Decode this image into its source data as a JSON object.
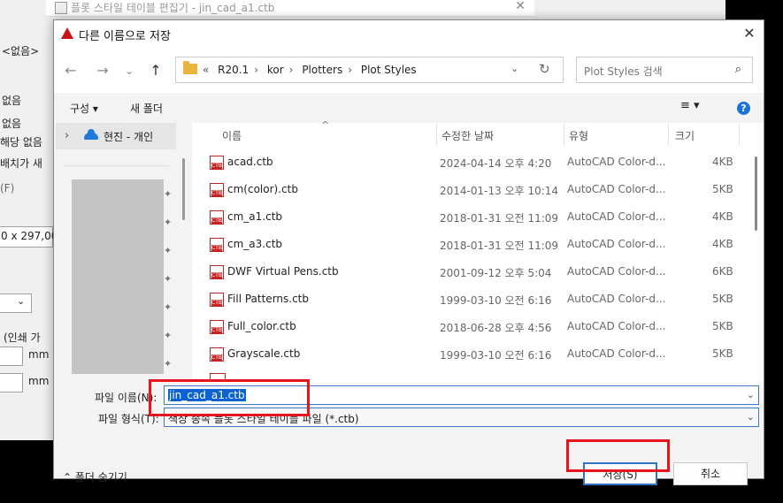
{
  "background_window": {
    "title": "플롯 스타일 테이블 편집기 - jin_cad_a1.ctb",
    "left_texts": [
      "<없음>",
      "없음",
      "없음",
      "해당 없음",
      "배치가 새",
      "(F)",
      "0 x 297,00",
      "(인쇄 가",
      "mm",
      "mm"
    ]
  },
  "dialog": {
    "title": "다른 이름으로 저장",
    "close": "✕"
  },
  "nav": {
    "back": "←",
    "forward": "→",
    "recent": "⌄",
    "up": "↑",
    "address_prefix": "«",
    "breadcrumbs": [
      "R20.1",
      "kor",
      "Plotters",
      "Plot Styles"
    ],
    "address_dropdown": "⌄",
    "refresh": "↻",
    "search_placeholder": "Plot Styles 검색",
    "search_icon_glyph": "⌕"
  },
  "toolbar": {
    "organize": "구성 ▾",
    "new_folder": "새 폴더",
    "view_icon": "≡ ▾",
    "help": "?"
  },
  "navpane": {
    "expand": "›",
    "onedrive_label": "현진 - 개인",
    "pin_glyph": "📌"
  },
  "file_list": {
    "sort_arrow": "^",
    "columns": {
      "name": "이름",
      "modified": "수정한 날짜",
      "type": "유형",
      "size": "크기"
    },
    "rows": [
      {
        "name": "acad.ctb",
        "modified": "2024-04-14 오후 4:20",
        "type": "AutoCAD Color-d...",
        "size": "4KB"
      },
      {
        "name": "cm(color).ctb",
        "modified": "2014-01-13 오후 10:14",
        "type": "AutoCAD Color-d...",
        "size": "5KB"
      },
      {
        "name": "cm_a1.ctb",
        "modified": "2018-01-31 오전 11:09",
        "type": "AutoCAD Color-d...",
        "size": "4KB"
      },
      {
        "name": "cm_a3.ctb",
        "modified": "2018-01-31 오전 11:09",
        "type": "AutoCAD Color-d...",
        "size": "4KB"
      },
      {
        "name": "DWF Virtual Pens.ctb",
        "modified": "2001-09-12 오후 5:04",
        "type": "AutoCAD Color-d...",
        "size": "6KB"
      },
      {
        "name": "Fill Patterns.ctb",
        "modified": "1999-03-10 오전 6:16",
        "type": "AutoCAD Color-d...",
        "size": "5KB"
      },
      {
        "name": "Full_color.ctb",
        "modified": "2018-06-28 오후 4:56",
        "type": "AutoCAD Color-d...",
        "size": "5KB"
      },
      {
        "name": "Grayscale.ctb",
        "modified": "1999-03-10 오전 6:16",
        "type": "AutoCAD Color-d...",
        "size": "5KB"
      }
    ]
  },
  "save_form": {
    "filename_label": "파일 이름(N):",
    "filename_value": "jin_cad_a1.ctb",
    "filetype_label": "파일 형식(T):",
    "filetype_value": "색상 종속 플롯 스타일 테이블 파일 (*.ctb)",
    "dropdown_glyph": "⌄"
  },
  "buttons": {
    "hide_folders": "⌃  폴더 숨기기",
    "save": "저장(S)",
    "cancel": "취소"
  },
  "colors": {
    "highlight_box": "#e8141b",
    "selection": "#0a62d3",
    "primary_border": "#2e73c6"
  }
}
